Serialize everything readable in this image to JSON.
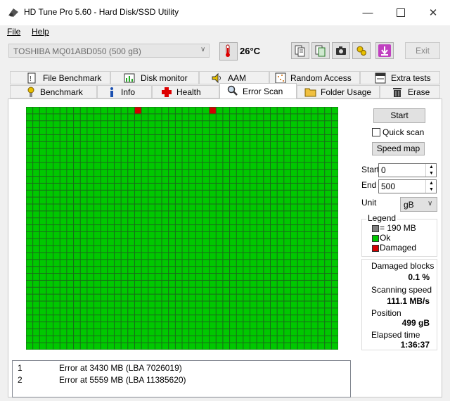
{
  "window": {
    "title": "HD Tune Pro 5.60 - Hard Disk/SSD Utility"
  },
  "menu": {
    "file": "File",
    "help": "Help"
  },
  "toolbar": {
    "drive": "TOSHIBA MQ01ABD050 (500 gB)",
    "temperature": "26°C",
    "exit_label": "Exit"
  },
  "tabs_top": [
    "File Benchmark",
    "Disk monitor",
    "AAM",
    "Random Access",
    "Extra tests"
  ],
  "tabs_bottom": [
    "Benchmark",
    "Info",
    "Health",
    "Error Scan",
    "Folder Usage",
    "Erase"
  ],
  "active_tab": "Error Scan",
  "scan": {
    "start_label": "Start",
    "quick_scan_label": "Quick scan",
    "quick_scan_checked": false,
    "speed_map_label": "Speed map",
    "start_field_label": "Start",
    "start_value": "0",
    "end_field_label": "End",
    "end_value": "500",
    "unit_label": "Unit",
    "unit_value": "gB"
  },
  "legend": {
    "title": "Legend",
    "block_size": "= 190 MB",
    "ok": "Ok",
    "damaged": "Damaged",
    "colors": {
      "ok": "#00c800",
      "damaged": "#d40000",
      "block": "#808080"
    }
  },
  "stats": {
    "damaged_blocks_label": "Damaged blocks",
    "damaged_blocks_value": "0.1 %",
    "scanning_speed_label": "Scanning speed",
    "scanning_speed_value": "111.1 MB/s",
    "position_label": "Position",
    "position_value": "499 gB",
    "elapsed_label": "Elapsed time",
    "elapsed_value": "1:36:37"
  },
  "grid": {
    "columns": 46,
    "rows": 35,
    "damaged_cells": [
      [
        0,
        16
      ],
      [
        0,
        27
      ]
    ]
  },
  "errors": [
    {
      "n": "1",
      "text": "Error at 3430 MB (LBA 7026019)"
    },
    {
      "n": "2",
      "text": "Error at 5559 MB (LBA 11385620)"
    }
  ]
}
